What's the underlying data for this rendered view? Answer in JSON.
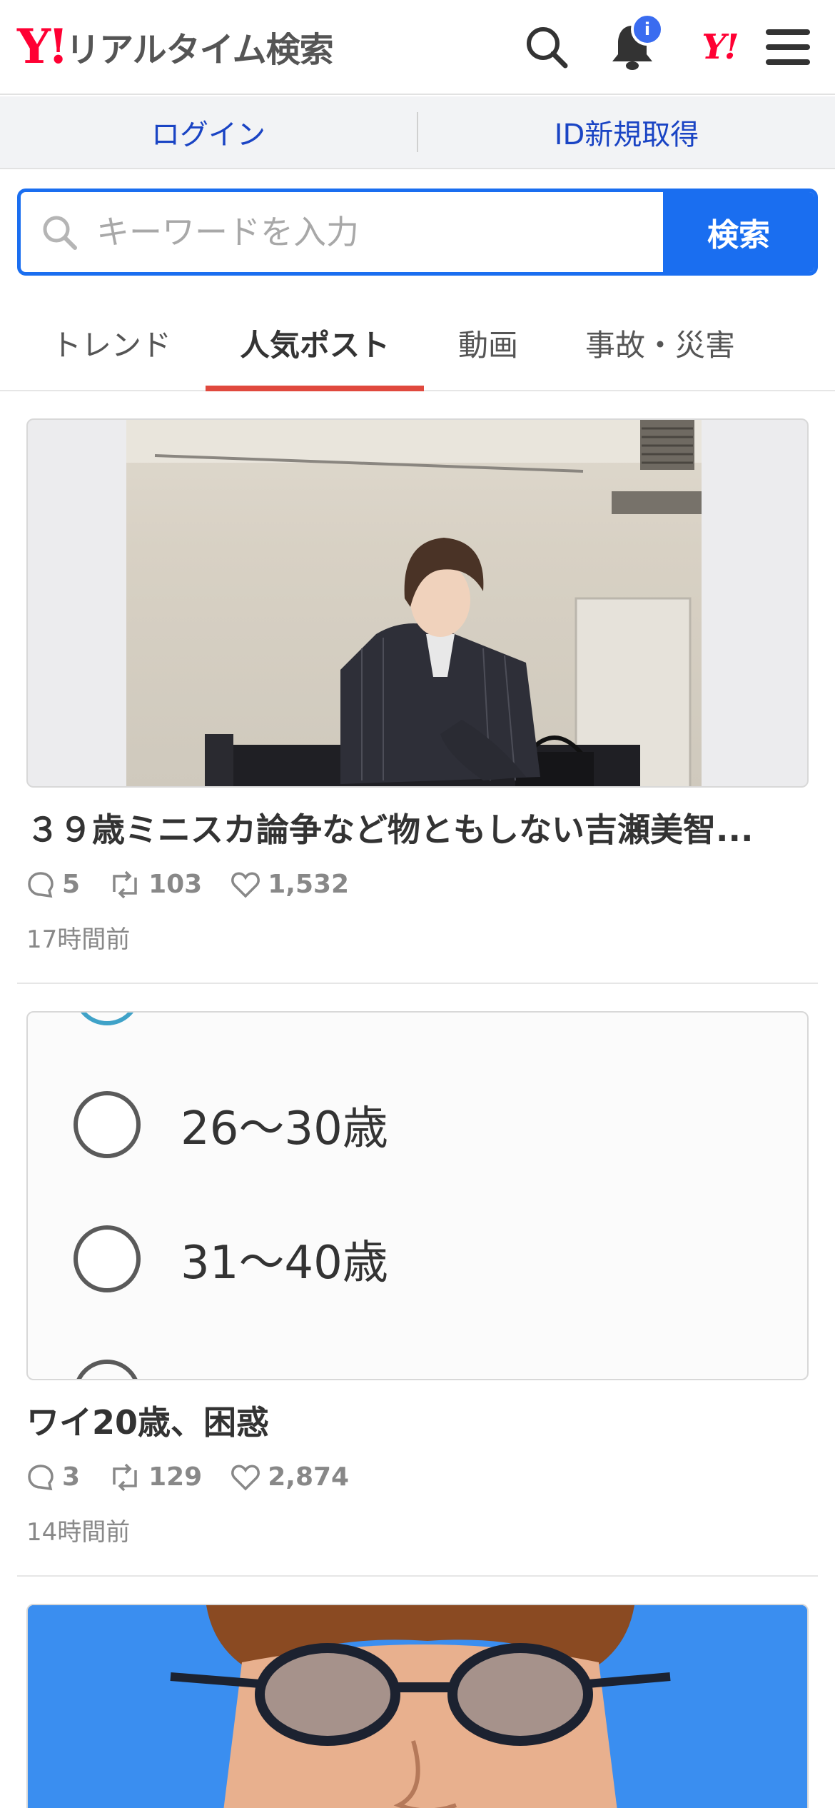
{
  "header": {
    "logo_mark": "Y!",
    "logo_text": "リアルタイム検索",
    "notification_badge": "i",
    "brand_link": "Y!"
  },
  "auth": {
    "login_label": "ログイン",
    "signup_label": "ID新規取得"
  },
  "search": {
    "placeholder": "キーワードを入力",
    "value": "",
    "button_label": "検索"
  },
  "tabs": [
    {
      "label": "トレンド",
      "active": false
    },
    {
      "label": "人気ポスト",
      "active": true
    },
    {
      "label": "動画",
      "active": false
    },
    {
      "label": "事故・災害",
      "active": false
    }
  ],
  "posts": [
    {
      "title": "３９歳ミニスカ論争など物ともしない吉瀬美智...",
      "replies": "5",
      "reposts": "103",
      "likes": "1,532",
      "time": "17時間前"
    },
    {
      "title": "ワイ20歳、困惑",
      "replies": "3",
      "reposts": "129",
      "likes": "2,874",
      "time": "14時間前",
      "poll_options": [
        "26〜30歳",
        "31〜40歳"
      ]
    }
  ],
  "icons": {
    "search": "search-icon",
    "bell": "bell-icon",
    "menu": "hamburger-menu-icon",
    "reply": "reply-bubble-icon",
    "repost": "repost-icon",
    "like": "heart-icon"
  },
  "colors": {
    "brand_red": "#ff0033",
    "link_blue": "#1a44c4",
    "search_blue": "#1a6ef0",
    "tab_active_underline": "#e0493e",
    "badge_blue": "#3a6cf0"
  }
}
